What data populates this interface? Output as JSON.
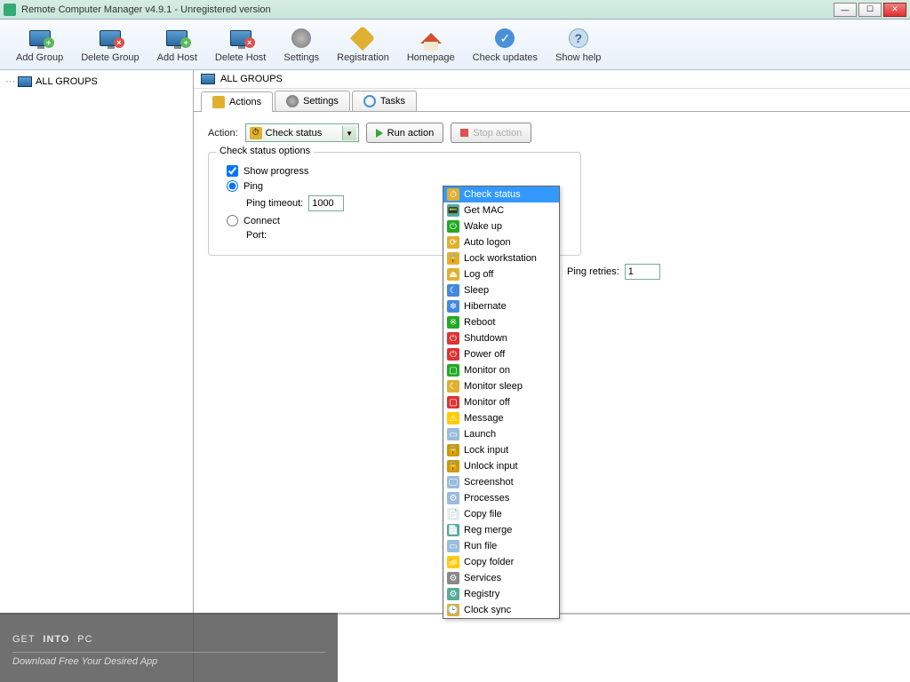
{
  "window": {
    "title": "Remote Computer Manager v4.9.1 - Unregistered version"
  },
  "toolbar": [
    {
      "label": "Add Group"
    },
    {
      "label": "Delete Group"
    },
    {
      "label": "Add Host"
    },
    {
      "label": "Delete Host"
    },
    {
      "label": "Settings"
    },
    {
      "label": "Registration"
    },
    {
      "label": "Homepage"
    },
    {
      "label": "Check updates"
    },
    {
      "label": "Show help"
    }
  ],
  "tree": {
    "root": "ALL GROUPS"
  },
  "main": {
    "header": "ALL GROUPS"
  },
  "tabs": [
    {
      "label": "Actions"
    },
    {
      "label": "Settings"
    },
    {
      "label": "Tasks"
    }
  ],
  "action_row": {
    "label": "Action:",
    "combo_value": "Check status",
    "run": "Run action",
    "stop": "Stop action"
  },
  "panel": {
    "legend": "Check status options",
    "show_progress": "Show progress",
    "ping_radio": "Ping",
    "ping_timeout_label": "Ping timeout:",
    "ping_timeout_value": "1000",
    "ping_retries_label": "Ping retries:",
    "ping_retries_value": "1",
    "connect_radio": "Connect",
    "port_label": "Port:"
  },
  "dropdown": [
    "Check status",
    "Get MAC",
    "Wake up",
    "Auto logon",
    "Lock workstation",
    "Log off",
    "Sleep",
    "Hibernate",
    "Reboot",
    "Shutdown",
    "Power off",
    "Monitor on",
    "Monitor sleep",
    "Monitor off",
    "Message",
    "Launch",
    "Lock input",
    "Unlock input",
    "Screenshot",
    "Processes",
    "Copy file",
    "Reg merge",
    "Run file",
    "Copy folder",
    "Services",
    "Registry",
    "Clock sync"
  ],
  "dropdown_icons": [
    "⏱",
    "📟",
    "⏻",
    "⟳",
    "🔒",
    "⏏",
    "☾",
    "❄",
    "※",
    "⏻",
    "⏻",
    "▢",
    "☾",
    "▢",
    "⚠",
    "▭",
    "🔒",
    "🔓",
    "🖵",
    "⚙",
    "📄",
    "📄",
    "▭",
    "📁",
    "⚙",
    "⚙",
    "🕒"
  ],
  "dropdown_icon_bg": [
    "#e0b030",
    "#5a9",
    "#2a2",
    "#e0b030",
    "#e0b030",
    "#e0b030",
    "#48d",
    "#48d",
    "#2a2",
    "#d33",
    "#d33",
    "#2a2",
    "#e0b030",
    "#d33",
    "#fc0",
    "#9bd",
    "#c90",
    "#c90",
    "#9bd",
    "#9bd",
    "#eee",
    "#5a9",
    "#9bd",
    "#fc0",
    "#888",
    "#5a9",
    "#e0b030"
  ],
  "watermark": {
    "line1a": "GET",
    "line1b": "INTO",
    "line1c": "PC",
    "sub": "Download Free Your Desired App"
  }
}
